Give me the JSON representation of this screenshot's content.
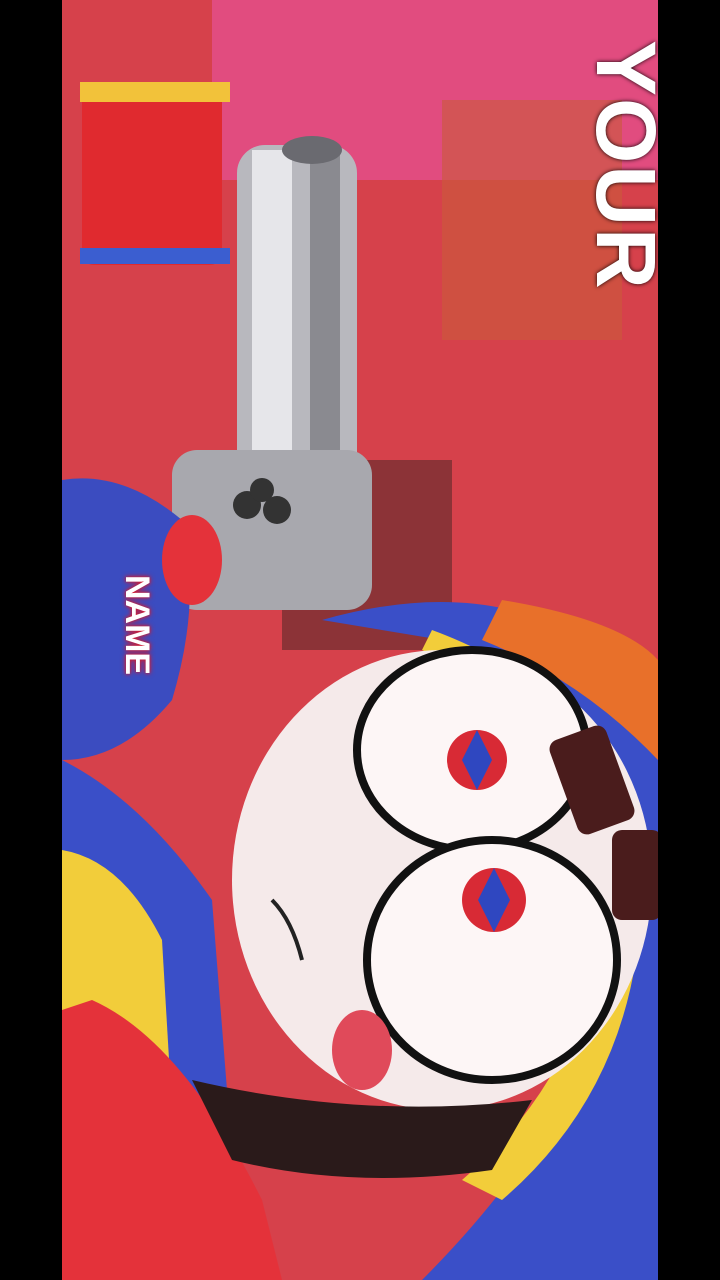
{
  "overlay": {
    "top_word": "YOUR",
    "small_word": "NAME"
  },
  "colors": {
    "background_red": "#d8434c",
    "face_white": "#f5eaea",
    "hat_blue": "#3a4fc8",
    "hat_yellow": "#f2cd3a",
    "gun_chrome": "#c8c8cc"
  }
}
